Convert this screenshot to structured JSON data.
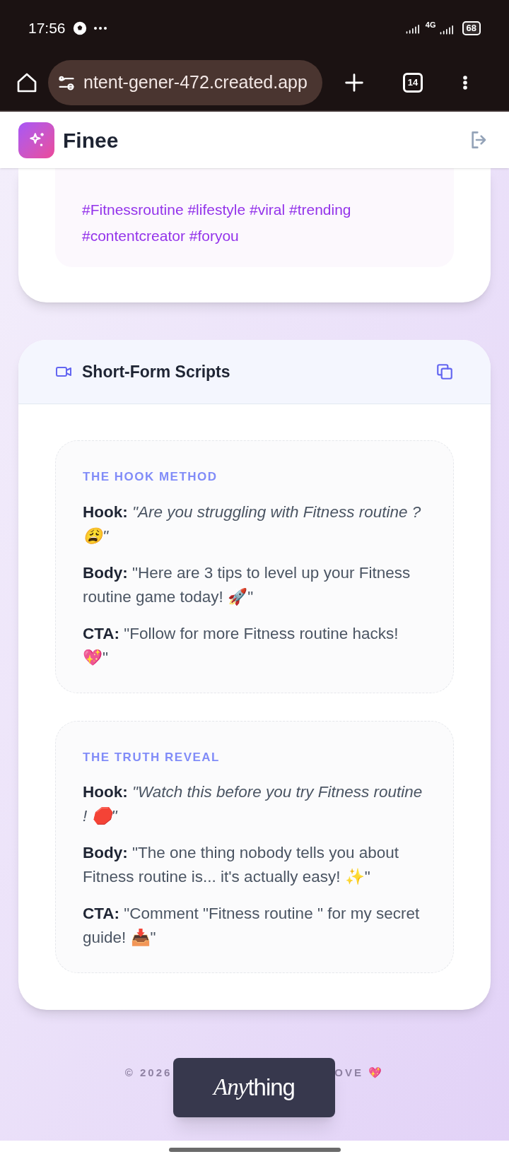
{
  "status_bar": {
    "time": "17:56",
    "network": "4G",
    "battery": "68"
  },
  "browser": {
    "url": "ntent-gener-472.created.app",
    "tab_count": "14"
  },
  "app": {
    "name": "Finee"
  },
  "hashtags": {
    "text": "#Fitnessroutine #lifestyle #viral #trending #contentcreator #foryou"
  },
  "scripts_card": {
    "title": "Short-Form Scripts",
    "scripts": [
      {
        "title": "THE HOOK METHOD",
        "lines": [
          "**Hook:** *\"Are you struggling with Fitness routine ? 😩\"*",
          "**Body:** \"Here are 3 tips to level up your Fitness routine game today! 🚀\"",
          "**CTA:** \"Follow for more Fitness routine hacks! 💖\""
        ]
      },
      {
        "title": "THE TRUTH REVEAL",
        "lines": [
          "**Hook:** *\"Watch this before you try Fitness routine ! 🛑\"*",
          "**Body:** \"The one thing nobody tells you about Fitness routine is... it's actually easy! ✨\"",
          "**CTA:** \"Comment \"Fitness routine \" for my secret guide! 📥\""
        ]
      }
    ]
  },
  "footer": {
    "left": "© 2026",
    "right": "OVE 💖"
  },
  "badge": {
    "italic": "Any",
    "rest": "thing"
  }
}
